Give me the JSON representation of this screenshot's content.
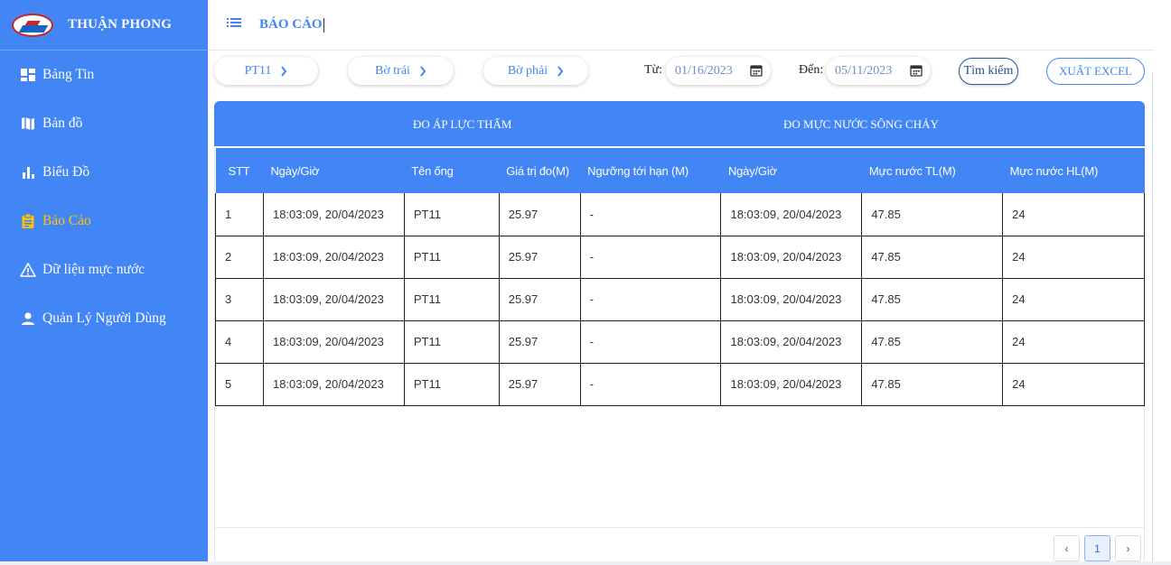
{
  "sidebar": {
    "brand": "THUẬN PHONG",
    "items": [
      {
        "label": "Bảng Tin",
        "icon": "dashboard-icon"
      },
      {
        "label": "Bản đồ",
        "icon": "map-icon"
      },
      {
        "label": "Biểu Đồ",
        "icon": "bar-chart-icon"
      },
      {
        "label": "Báo Cáo",
        "icon": "clipboard-icon",
        "active": true
      },
      {
        "label": "Dữ liệu mực nước",
        "icon": "warning-icon"
      },
      {
        "label": "Quản Lý Người Dùng",
        "icon": "person-icon"
      }
    ]
  },
  "header": {
    "title": "BÁO CÁO"
  },
  "filters": {
    "station": "PT11",
    "left_bank": "Bờ trái",
    "right_bank": "Bờ phải",
    "from_label": "Từ:",
    "from_date": "01/16/2023",
    "to_label": "Đến:",
    "to_date": "05/11/2023",
    "search_label": "Tìm kiếm",
    "export_label": "XUẤT EXCEL"
  },
  "table": {
    "groups": [
      "ĐO ÁP LỰC THẤM",
      "ĐO MỰC NƯỚC SÔNG CHẢY"
    ],
    "columns": [
      "STT",
      "Ngày/Giờ",
      "Tên ống",
      "Giá trị đo(M)",
      "Ngưỡng tới hạn (M)",
      "Ngày/Giờ",
      "Mực nước TL(M)",
      "Mực nước HL(M)"
    ],
    "rows": [
      [
        "1",
        "18:03:09, 20/04/2023",
        "PT11",
        "25.97",
        "-",
        "18:03:09, 20/04/2023",
        "47.85",
        "24"
      ],
      [
        "2",
        "18:03:09, 20/04/2023",
        "PT11",
        "25.97",
        "-",
        "18:03:09, 20/04/2023",
        "47.85",
        "24"
      ],
      [
        "3",
        "18:03:09, 20/04/2023",
        "PT11",
        "25.97",
        "-",
        "18:03:09, 20/04/2023",
        "47.85",
        "24"
      ],
      [
        "4",
        "18:03:09, 20/04/2023",
        "PT11",
        "25.97",
        "-",
        "18:03:09, 20/04/2023",
        "47.85",
        "24"
      ],
      [
        "5",
        "18:03:09, 20/04/2023",
        "PT11",
        "25.97",
        "-",
        "18:03:09, 20/04/2023",
        "47.85",
        "24"
      ]
    ]
  },
  "pagination": {
    "current": "1",
    "prev": "‹",
    "next": "›"
  },
  "colors": {
    "primary": "#4285f4",
    "active_nav": "#ffc107"
  }
}
